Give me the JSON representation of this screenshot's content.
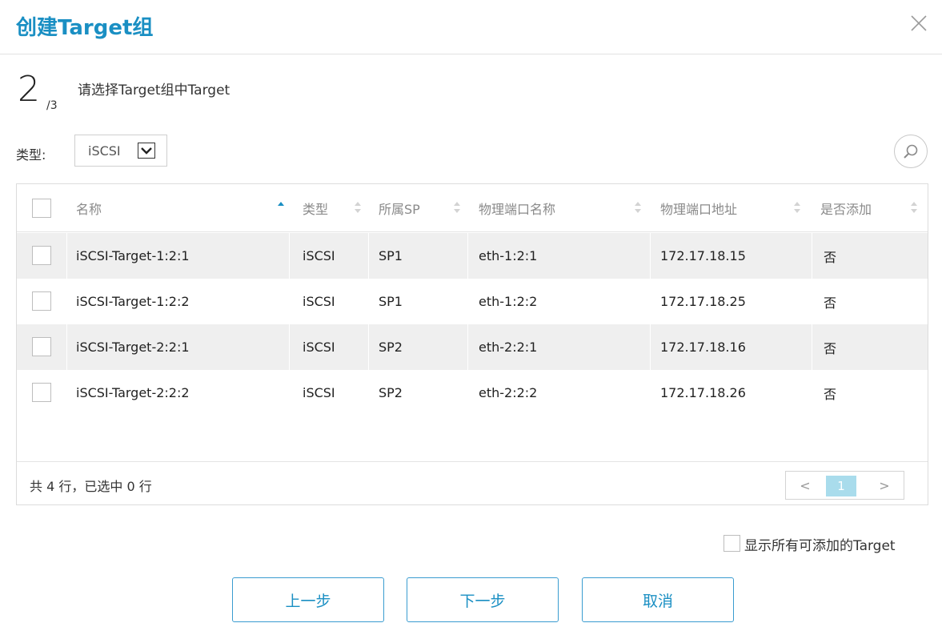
{
  "dialog": {
    "title": "创建Target组"
  },
  "step": {
    "current": "2",
    "total": "/3",
    "description": "请选择Target组中Target"
  },
  "filter": {
    "type_label": "类型:",
    "type_value": "iSCSI"
  },
  "table": {
    "columns": [
      {
        "label": "名称",
        "sort": "asc"
      },
      {
        "label": "类型",
        "sort": "none"
      },
      {
        "label": "所属SP",
        "sort": "none"
      },
      {
        "label": "物理端口名称",
        "sort": "none"
      },
      {
        "label": "物理端口地址",
        "sort": "none"
      },
      {
        "label": "是否添加",
        "sort": "none"
      }
    ],
    "rows": [
      {
        "name": "iSCSI-Target-1:2:1",
        "type": "iSCSI",
        "sp": "SP1",
        "port_name": "eth-1:2:1",
        "port_addr": "172.17.18.15",
        "added": "否"
      },
      {
        "name": "iSCSI-Target-1:2:2",
        "type": "iSCSI",
        "sp": "SP1",
        "port_name": "eth-1:2:2",
        "port_addr": "172.17.18.25",
        "added": "否"
      },
      {
        "name": "iSCSI-Target-2:2:1",
        "type": "iSCSI",
        "sp": "SP2",
        "port_name": "eth-2:2:1",
        "port_addr": "172.17.18.16",
        "added": "否"
      },
      {
        "name": "iSCSI-Target-2:2:2",
        "type": "iSCSI",
        "sp": "SP2",
        "port_name": "eth-2:2:2",
        "port_addr": "172.17.18.26",
        "added": "否"
      }
    ],
    "footer_text": "共 4 行，已选中 0 行"
  },
  "pagination": {
    "prev": "<",
    "current": "1",
    "next": ">"
  },
  "show_all_label": "显示所有可添加的Target",
  "buttons": {
    "prev": "上一步",
    "next": "下一步",
    "cancel": "取消"
  },
  "colors": {
    "accent": "#1a8fc3",
    "page_active": "#a9dcec",
    "sort_active": "#1a8fc3",
    "row_stripe": "#efefef"
  },
  "icons": {
    "close": "close-icon",
    "search": "search-icon",
    "dropdown": "chevron-down-icon"
  }
}
